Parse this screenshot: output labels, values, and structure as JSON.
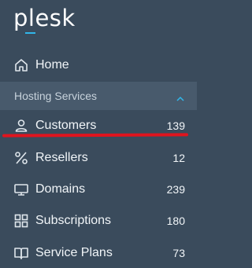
{
  "brand": {
    "logo_text": "plesk",
    "accent": "#30b6ea"
  },
  "nav": {
    "home": {
      "label": "Home",
      "icon": "home-icon"
    },
    "group": {
      "title": "Hosting Services",
      "icon": "chevron-up-icon"
    },
    "items": [
      {
        "label": "Customers",
        "count": "139",
        "icon": "user-icon"
      },
      {
        "label": "Resellers",
        "count": "12",
        "icon": "percent-icon"
      },
      {
        "label": "Domains",
        "count": "239",
        "icon": "monitor-icon"
      },
      {
        "label": "Subscriptions",
        "count": "180",
        "icon": "grid-icon"
      },
      {
        "label": "Service Plans",
        "count": "73",
        "icon": "book-icon"
      }
    ]
  },
  "annotation": {
    "color": "#e0141e"
  }
}
